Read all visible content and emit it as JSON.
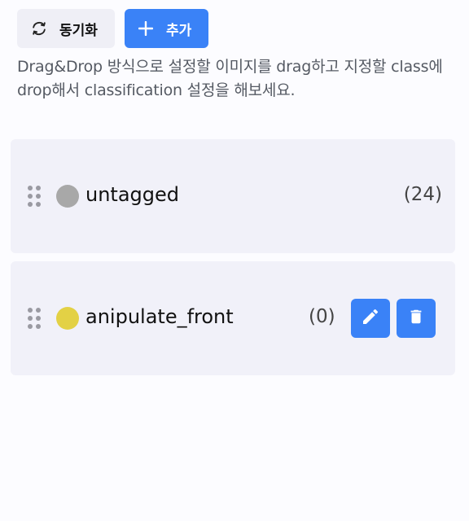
{
  "toolbar": {
    "sync_label": "동기화",
    "sync_icon": "sync-icon",
    "add_label": "추가",
    "add_icon": "plus-icon"
  },
  "description": "Drag&Drop 방식으로 설정할 이미지를 drag하고 지정할 class에 drop해서 classification 설정을 해보세요.",
  "classes": [
    {
      "name": "untagged",
      "count": "(24)",
      "color": "#a8a8a8",
      "editable": false
    },
    {
      "name": "anipulate_front",
      "count": "(0)",
      "color": "#e3d145",
      "editable": true,
      "actions": [
        "edit-icon",
        "trash-icon"
      ]
    }
  ],
  "colors": {
    "accent": "#3a82f7",
    "card_bg": "#f1f1f9",
    "page_bg": "#fcfcff"
  }
}
